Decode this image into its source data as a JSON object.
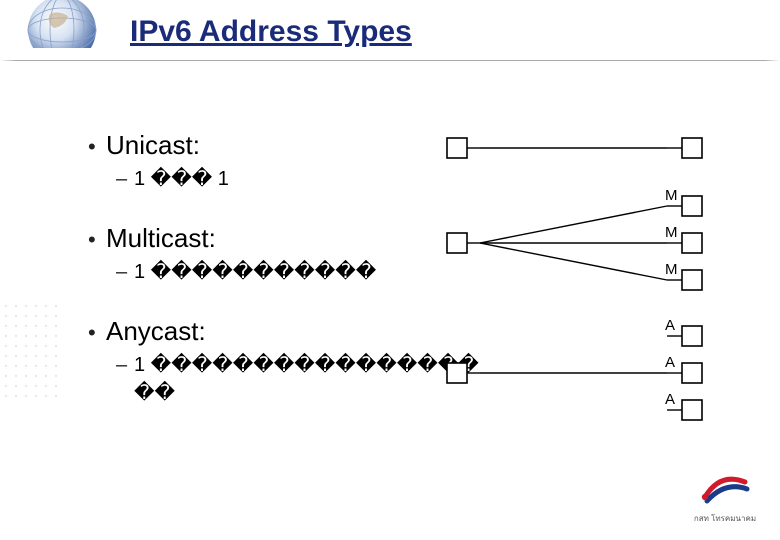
{
  "title": "IPv6 Address Types",
  "items": [
    {
      "heading": "Unicast:",
      "sub": "1 ��� 1"
    },
    {
      "heading": "Multicast:",
      "sub": "1 �����������"
    },
    {
      "heading": "Anycast:",
      "sub": "1 ������������������"
    }
  ],
  "labels": {
    "m": "M",
    "a": "A"
  },
  "logo_text": "กสท โทรคมนาคม"
}
